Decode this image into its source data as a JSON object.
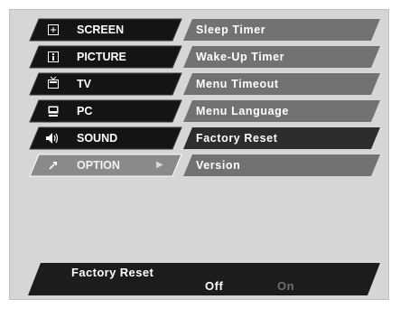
{
  "categories": [
    {
      "label": "SCREEN",
      "icon": "screen-icon"
    },
    {
      "label": "PICTURE",
      "icon": "picture-icon"
    },
    {
      "label": "TV",
      "icon": "tv-icon"
    },
    {
      "label": "PC",
      "icon": "pc-icon"
    },
    {
      "label": "SOUND",
      "icon": "sound-icon"
    },
    {
      "label": "OPTION",
      "icon": "option-icon",
      "active": true
    }
  ],
  "submenu": [
    {
      "label": "Sleep Timer"
    },
    {
      "label": "Wake-Up Timer"
    },
    {
      "label": "Menu Timeout"
    },
    {
      "label": "Menu Language"
    },
    {
      "label": "Factory Reset",
      "selected": true
    },
    {
      "label": "Version"
    }
  ],
  "status": {
    "title": "Factory Reset",
    "options": [
      {
        "label": "Off",
        "selected": true
      },
      {
        "label": "On",
        "selected": false
      }
    ]
  },
  "colors": {
    "background": "#d6d6d6",
    "category_fill": "#141414",
    "category_active_fill": "#8a8a8a",
    "submenu_fill": "#727272",
    "submenu_selected_fill": "#2d2d2d",
    "status_fill": "#1c1c1c",
    "option_selected": "#ffffff",
    "option_dim": "#6f6f6f"
  }
}
